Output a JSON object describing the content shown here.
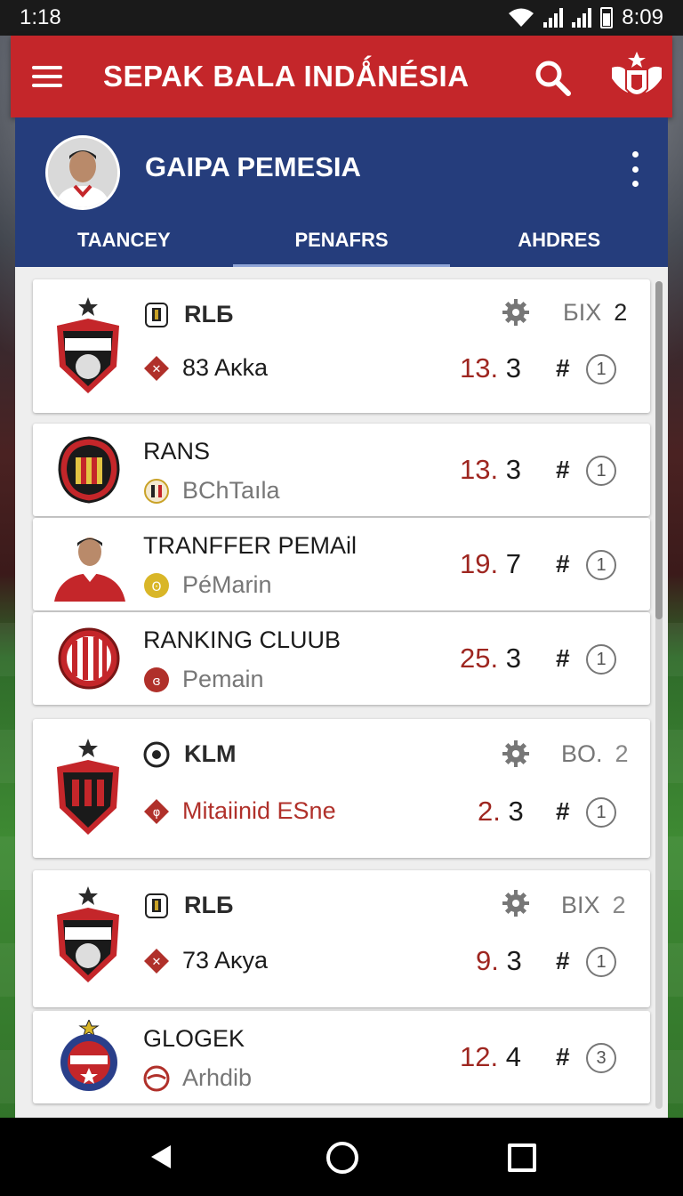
{
  "status_bar": {
    "time_left": "1:18",
    "time_right": "8:09"
  },
  "app_bar": {
    "title": "SEPAK BALA INDǺNÉSIA"
  },
  "profile": {
    "name": "GAIPA PEMESIA",
    "tabs": [
      {
        "label": "TAANCEY"
      },
      {
        "label": "PENAFRS"
      },
      {
        "label": "AHDRES"
      }
    ],
    "active_tab": 1
  },
  "cards": [
    {
      "title": "RLБ",
      "subtitle": "83 Aĸka",
      "value_int": "13.",
      "value_dec": "3",
      "meta_label": "БІХ",
      "meta_value": "2",
      "rank": "1",
      "accent": "#b0302a"
    },
    {
      "title": "RANS",
      "subtitle": "BChTaıla",
      "value_int": "13.",
      "value_dec": "3",
      "rank": "1"
    },
    {
      "title": "TRANFFER PEMAil",
      "subtitle": "PéMarin",
      "value_int": "19.",
      "value_dec": "7",
      "rank": "1"
    },
    {
      "title": "RANKING CLUUB",
      "subtitle": "Pemain",
      "value_int": "25.",
      "value_dec": "3",
      "rank": "1"
    },
    {
      "title": "KLM",
      "subtitle": "Mitaiinid ESne",
      "value_int": "2.",
      "value_dec": "3",
      "meta_label": "BO.",
      "meta_value": "2",
      "rank": "1"
    },
    {
      "title": "RLБ",
      "subtitle": "73 Aĸya",
      "value_int": "9.",
      "value_dec": "3",
      "meta_label": "BIX",
      "meta_value": "2",
      "rank": "1"
    },
    {
      "title": "GLOGEK",
      "subtitle": "Arhdib",
      "value_int": "12.",
      "value_dec": "4",
      "rank": "3"
    }
  ],
  "hash_symbol": "#",
  "colors": {
    "app_bar": "#c4262a",
    "header": "#253d7c",
    "value_red": "#9e2620"
  }
}
